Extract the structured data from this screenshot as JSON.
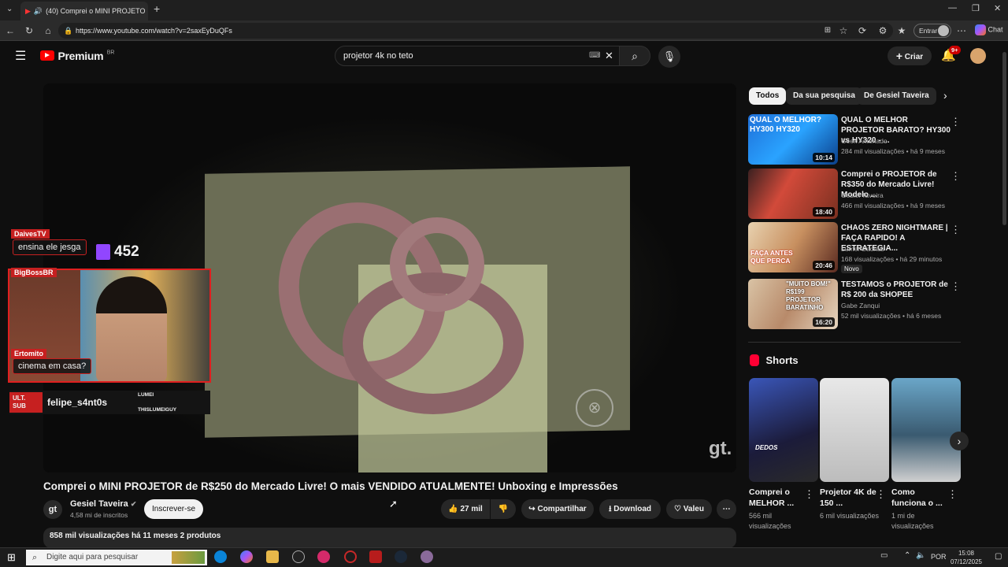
{
  "browser": {
    "tab_title": "(40) Comprei o MINI PROJETO",
    "url": "https://www.youtube.com/watch?v=2saxEyDuQFs",
    "profile_label": "Entrar",
    "chat_label": "Chat"
  },
  "masthead": {
    "logo": "Premium",
    "logo_region": "BR",
    "search_query": "projetor 4k no teto",
    "create_label": "Criar",
    "notif_count": "9+"
  },
  "overlay": {
    "chat": [
      {
        "user": "DaivesTV",
        "message": "ensina ele jesga"
      },
      {
        "user": "BigBossBR",
        "message": ""
      },
      {
        "user": "Ertomito",
        "message": "cinema em casa?"
      }
    ],
    "viewer_count": "452",
    "sub_label": "ULT. SUB",
    "sub_user": "felipe_s4nt0s",
    "tags": [
      "LUMEI",
      "THISLUMEIGUY"
    ],
    "watermark": "gt."
  },
  "video": {
    "title": "Comprei o MINI PROJETOR de R$250 do Mercado Livre! O mais VENDIDO ATUALMENTE! Unboxing e Impressões",
    "channel": "Gesiel Taveira",
    "channel_avatar": "gt",
    "subscribers": "4,58 mi de inscritos",
    "subscribe_label": "Inscrever-se",
    "likes": "27 mil",
    "share_label": "Compartilhar",
    "download_label": "Download",
    "thanks_label": "Valeu",
    "description_meta": "858 mil visualizações  há 11 meses  2 produtos"
  },
  "sidebar": {
    "chips": [
      "Todos",
      "Da sua pesquisa",
      "De Gesiel Taveira"
    ],
    "recommendations": [
      {
        "title": "QUAL O MELHOR PROJETOR BARATO? HY300 vs HY320 - ...",
        "channel": "Geek Antenado",
        "meta": "284 mil visualizações • há 9 meses",
        "duration": "10:14",
        "thumb_text": "QUAL O MELHOR? HY300 HY320",
        "badge": ""
      },
      {
        "title": "Comprei o PROJETOR de R$350 do Mercado Livre! Modelo ...",
        "channel": "Gesiel Taveira",
        "meta": "466 mil visualizações • há 9 meses",
        "duration": "18:40",
        "thumb_text": "",
        "badge": ""
      },
      {
        "title": "CHAOS ZERO NIGHTMARE | FAÇA RAPIDO! A ESTRATEGIA...",
        "channel": "Lumei Gachas",
        "meta": "168 visualizações • há 29 minutos",
        "duration": "20:46",
        "thumb_text": "FAÇA ANTES QUE PERCA",
        "badge": "Novo"
      },
      {
        "title": "TESTAMOS o PROJETOR de R$ 200 da SHOPEE",
        "channel": "Gabe Zanqui",
        "meta": "52 mil visualizações • há 6 meses",
        "duration": "16:20",
        "thumb_text": "\"MUITO BOM!\" R$199 PROJETOR BARATINHO",
        "badge": ""
      }
    ],
    "shorts_heading": "Shorts",
    "shorts": [
      {
        "title": "Comprei o MELHOR ...",
        "views": "566 mil visualizações",
        "thumb_text": "DEDOS"
      },
      {
        "title": "Projetor 4K de 150 ...",
        "views": "6 mil visualizações",
        "thumb_text": ""
      },
      {
        "title": "Como funciona o ...",
        "views": "1 mi de visualizações",
        "thumb_text": ""
      }
    ]
  },
  "taskbar": {
    "search_placeholder": "Digite aqui para pesquisar",
    "lang": "POR",
    "time": "15:08",
    "date": "07/12/2025"
  },
  "colors": {
    "accent": "#ff0000",
    "twitch": "#9146ff",
    "chrome_bg": "#1f1f1f"
  }
}
